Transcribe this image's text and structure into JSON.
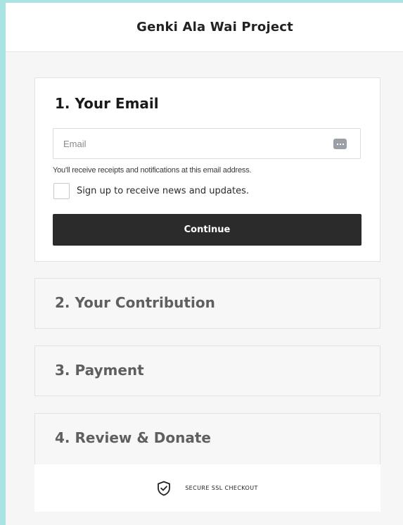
{
  "header": {
    "title": "Genki Ala Wai Project"
  },
  "steps": [
    {
      "label": "1.  Your Email"
    },
    {
      "label": "2.  Your Contribution"
    },
    {
      "label": "3.  Payment"
    },
    {
      "label": "4.  Review & Donate"
    }
  ],
  "email_step": {
    "email_placeholder": "Email",
    "email_value": "",
    "helper_text": "You'll receive receipts and notifications at this email address.",
    "newsletter_label": "Sign up to receive news and updates.",
    "newsletter_checked": false,
    "continue_label": "Continue"
  },
  "footer": {
    "secure_text": "SECURE SSL CHECKOUT"
  },
  "icons": {
    "autofill": "password-autofill-icon",
    "shield": "shield-check-icon"
  },
  "colors": {
    "page_background": "#a9e4e3",
    "panel_background": "#f6f6f6",
    "button_background": "#2b2b2b",
    "button_text": "#ffffff"
  }
}
